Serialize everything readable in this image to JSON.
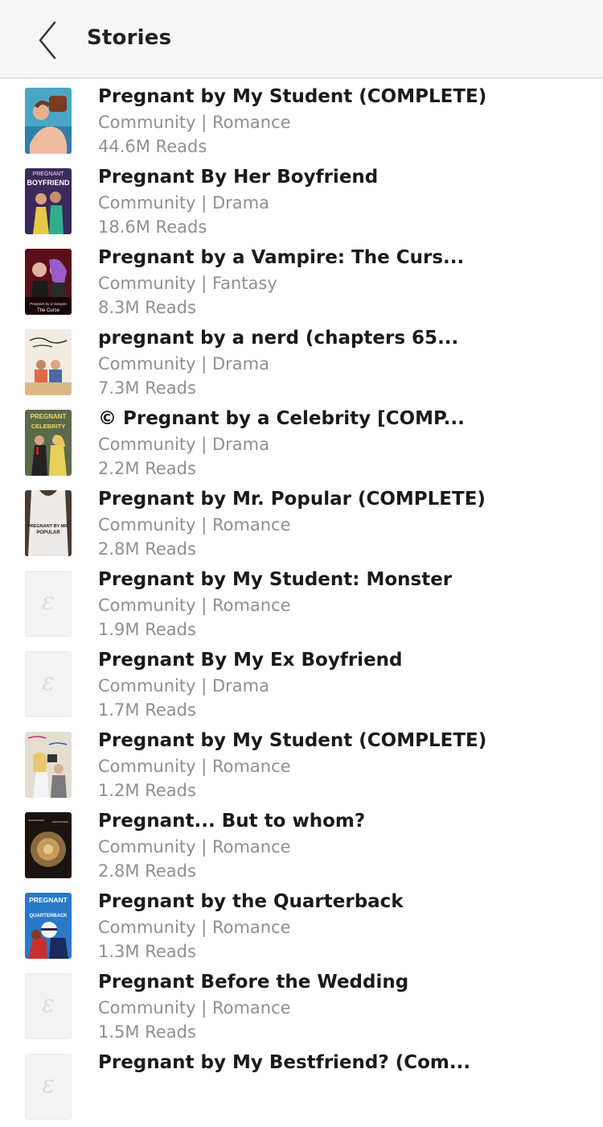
{
  "header": {
    "title": "Stories"
  },
  "stories": [
    {
      "title": "Pregnant by My Student (COMPLETE)",
      "meta": "Community | Romance",
      "reads": "44.6M Reads"
    },
    {
      "title": "Pregnant By Her Boyfriend",
      "meta": "Community | Drama",
      "reads": "18.6M Reads",
      "cover_text": [
        "PREGNANT",
        "BOYFRIEND"
      ]
    },
    {
      "title": "Pregnant by a Vampire: The Curs...",
      "meta": "Community | Fantasy",
      "reads": "8.3M Reads",
      "cover_text": [
        "Pregnant by a Vampire",
        "The Curse"
      ]
    },
    {
      "title": "pregnant by a nerd (chapters 65...",
      "meta": "Community | Drama",
      "reads": "7.3M Reads"
    },
    {
      "title": "© Pregnant by a Celebrity [COMP...",
      "meta": "Community | Drama",
      "reads": "2.2M Reads",
      "cover_text": [
        "PREGNANT",
        "CELEBRITY"
      ]
    },
    {
      "title": "Pregnant by Mr. Popular (COMPLETE)",
      "meta": "Community | Romance",
      "reads": "2.8M Reads",
      "cover_text": [
        "PREGNANT BY MR.",
        "POPULAR"
      ]
    },
    {
      "title": "Pregnant by My Student: Monster",
      "meta": "Community | Romance",
      "reads": "1.9M Reads"
    },
    {
      "title": "Pregnant By My Ex Boyfriend",
      "meta": "Community | Drama",
      "reads": "1.7M Reads"
    },
    {
      "title": "Pregnant by My Student (COMPLETE)",
      "meta": "Community | Romance",
      "reads": "1.2M Reads"
    },
    {
      "title": "Pregnant... But to whom?",
      "meta": "Community | Romance",
      "reads": "2.8M Reads"
    },
    {
      "title": "Pregnant by the Quarterback",
      "meta": "Community | Romance",
      "reads": "1.3M Reads",
      "cover_text": [
        "PREGNANT",
        "QUARTERBACK"
      ]
    },
    {
      "title": "Pregnant Before the Wedding",
      "meta": "Community | Romance",
      "reads": "1.5M Reads"
    },
    {
      "title": "Pregnant by My Bestfriend? (Com...",
      "meta": "",
      "reads": ""
    }
  ],
  "placeholder_glyph": "ε"
}
